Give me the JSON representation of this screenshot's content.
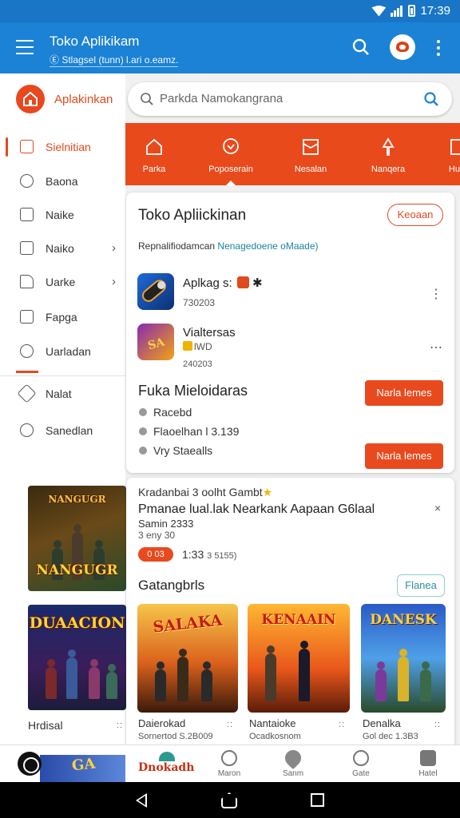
{
  "status_bar": {
    "time": "17:39"
  },
  "app_bar": {
    "title": "Toko Aplikikam",
    "subtitle": "Ⓔ Stlagsel (tunn) l.ari o.eamz.",
    "icons": [
      "menu-icon",
      "search-icon",
      "avatar-icon",
      "more-vert-icon"
    ]
  },
  "sidebar": {
    "app_name": "Aplakinkan",
    "items": [
      {
        "label": "Sielnitian",
        "icon": "grid-icon",
        "active": true
      },
      {
        "label": "Baona",
        "icon": "clock-icon"
      },
      {
        "label": "Naike",
        "icon": "square-icon"
      },
      {
        "label": "Naiko",
        "icon": "play-icon",
        "has_chevron": true
      },
      {
        "label": "Uarke",
        "icon": "hand-icon",
        "has_chevron": true
      },
      {
        "label": "Fapga",
        "icon": "home-icon"
      },
      {
        "label": "Uarladan",
        "icon": "dial-icon"
      },
      {
        "label": "Nalat",
        "icon": "pencil-icon"
      },
      {
        "label": "Sanedlan",
        "icon": "cloud-icon"
      }
    ],
    "chevron": "›",
    "promo_games": [
      {
        "art_title": "NANGUGR"
      },
      {
        "art_title": "DUAACION"
      }
    ],
    "promo_label": "Hrdisal",
    "promo_dots": "::"
  },
  "search": {
    "placeholder": "Parkda Namokangrana"
  },
  "categories": [
    {
      "label": "Parka",
      "icon": "house-icon"
    },
    {
      "label": "Poposerain",
      "icon": "chat-icon",
      "selected": true
    },
    {
      "label": "Nesalan",
      "icon": "book-icon"
    },
    {
      "label": "Nanqera",
      "icon": "pin-icon"
    },
    {
      "label": "Hua",
      "icon": "flag-icon"
    }
  ],
  "main_card": {
    "title": "Toko Apliickinan",
    "pill_button": "Keoaan",
    "subtitle_prefix": "Repnalifiodamcan ",
    "subtitle_highlight": "Nenagedoene oMaade)",
    "apps": [
      {
        "name": "Aplkag s:",
        "meta": "730203",
        "more": "⋮"
      },
      {
        "name": "Vialtersas",
        "meta": "lWD",
        "meta2": "240203",
        "more": "⋯"
      }
    ],
    "featured_title": "Fuka Mieloidaras",
    "featured_button": "Narla lemes",
    "bullets": [
      "Racebd",
      "Flaoelhan l 3.139",
      "Vry Staealls"
    ],
    "bottom_button": "Narla lemes"
  },
  "card2": {
    "title": "Kradanbai 3 oolht Gambt",
    "headline": "Pmanae lual.lak Nearkank Aapaan G6laal",
    "sub": "Samin 2333",
    "sub2": "3 eny 30",
    "badge": "0 03",
    "time": "1:33",
    "time_small": "3 5155)",
    "close": "×",
    "categories_heading": "Gatangbrls",
    "outline_button": "Flanea",
    "games": [
      {
        "art_title": "SALAKA",
        "label": "Daierokad",
        "sub": "Sornertod S.2B009"
      },
      {
        "art_title": "KENAAIN",
        "label": "Nantaioke",
        "sub": "Ocadkosnom"
      },
      {
        "art_title": "DANESK",
        "label": "Denalka",
        "sub": "Gol dec 1.3B3"
      }
    ],
    "dots": "::"
  },
  "bottom_nav": {
    "active_label": "Dnokadh",
    "items": [
      {
        "label": "Maron",
        "icon": "target-icon"
      },
      {
        "label": "Sanm",
        "icon": "heart-icon"
      },
      {
        "label": "Gate",
        "icon": "search-icon"
      },
      {
        "label": "Hatel",
        "icon": "bag-icon"
      }
    ]
  },
  "colors": {
    "primary": "#1b82d6",
    "accent": "#e84a1e",
    "teal": "#2b8fa0"
  }
}
